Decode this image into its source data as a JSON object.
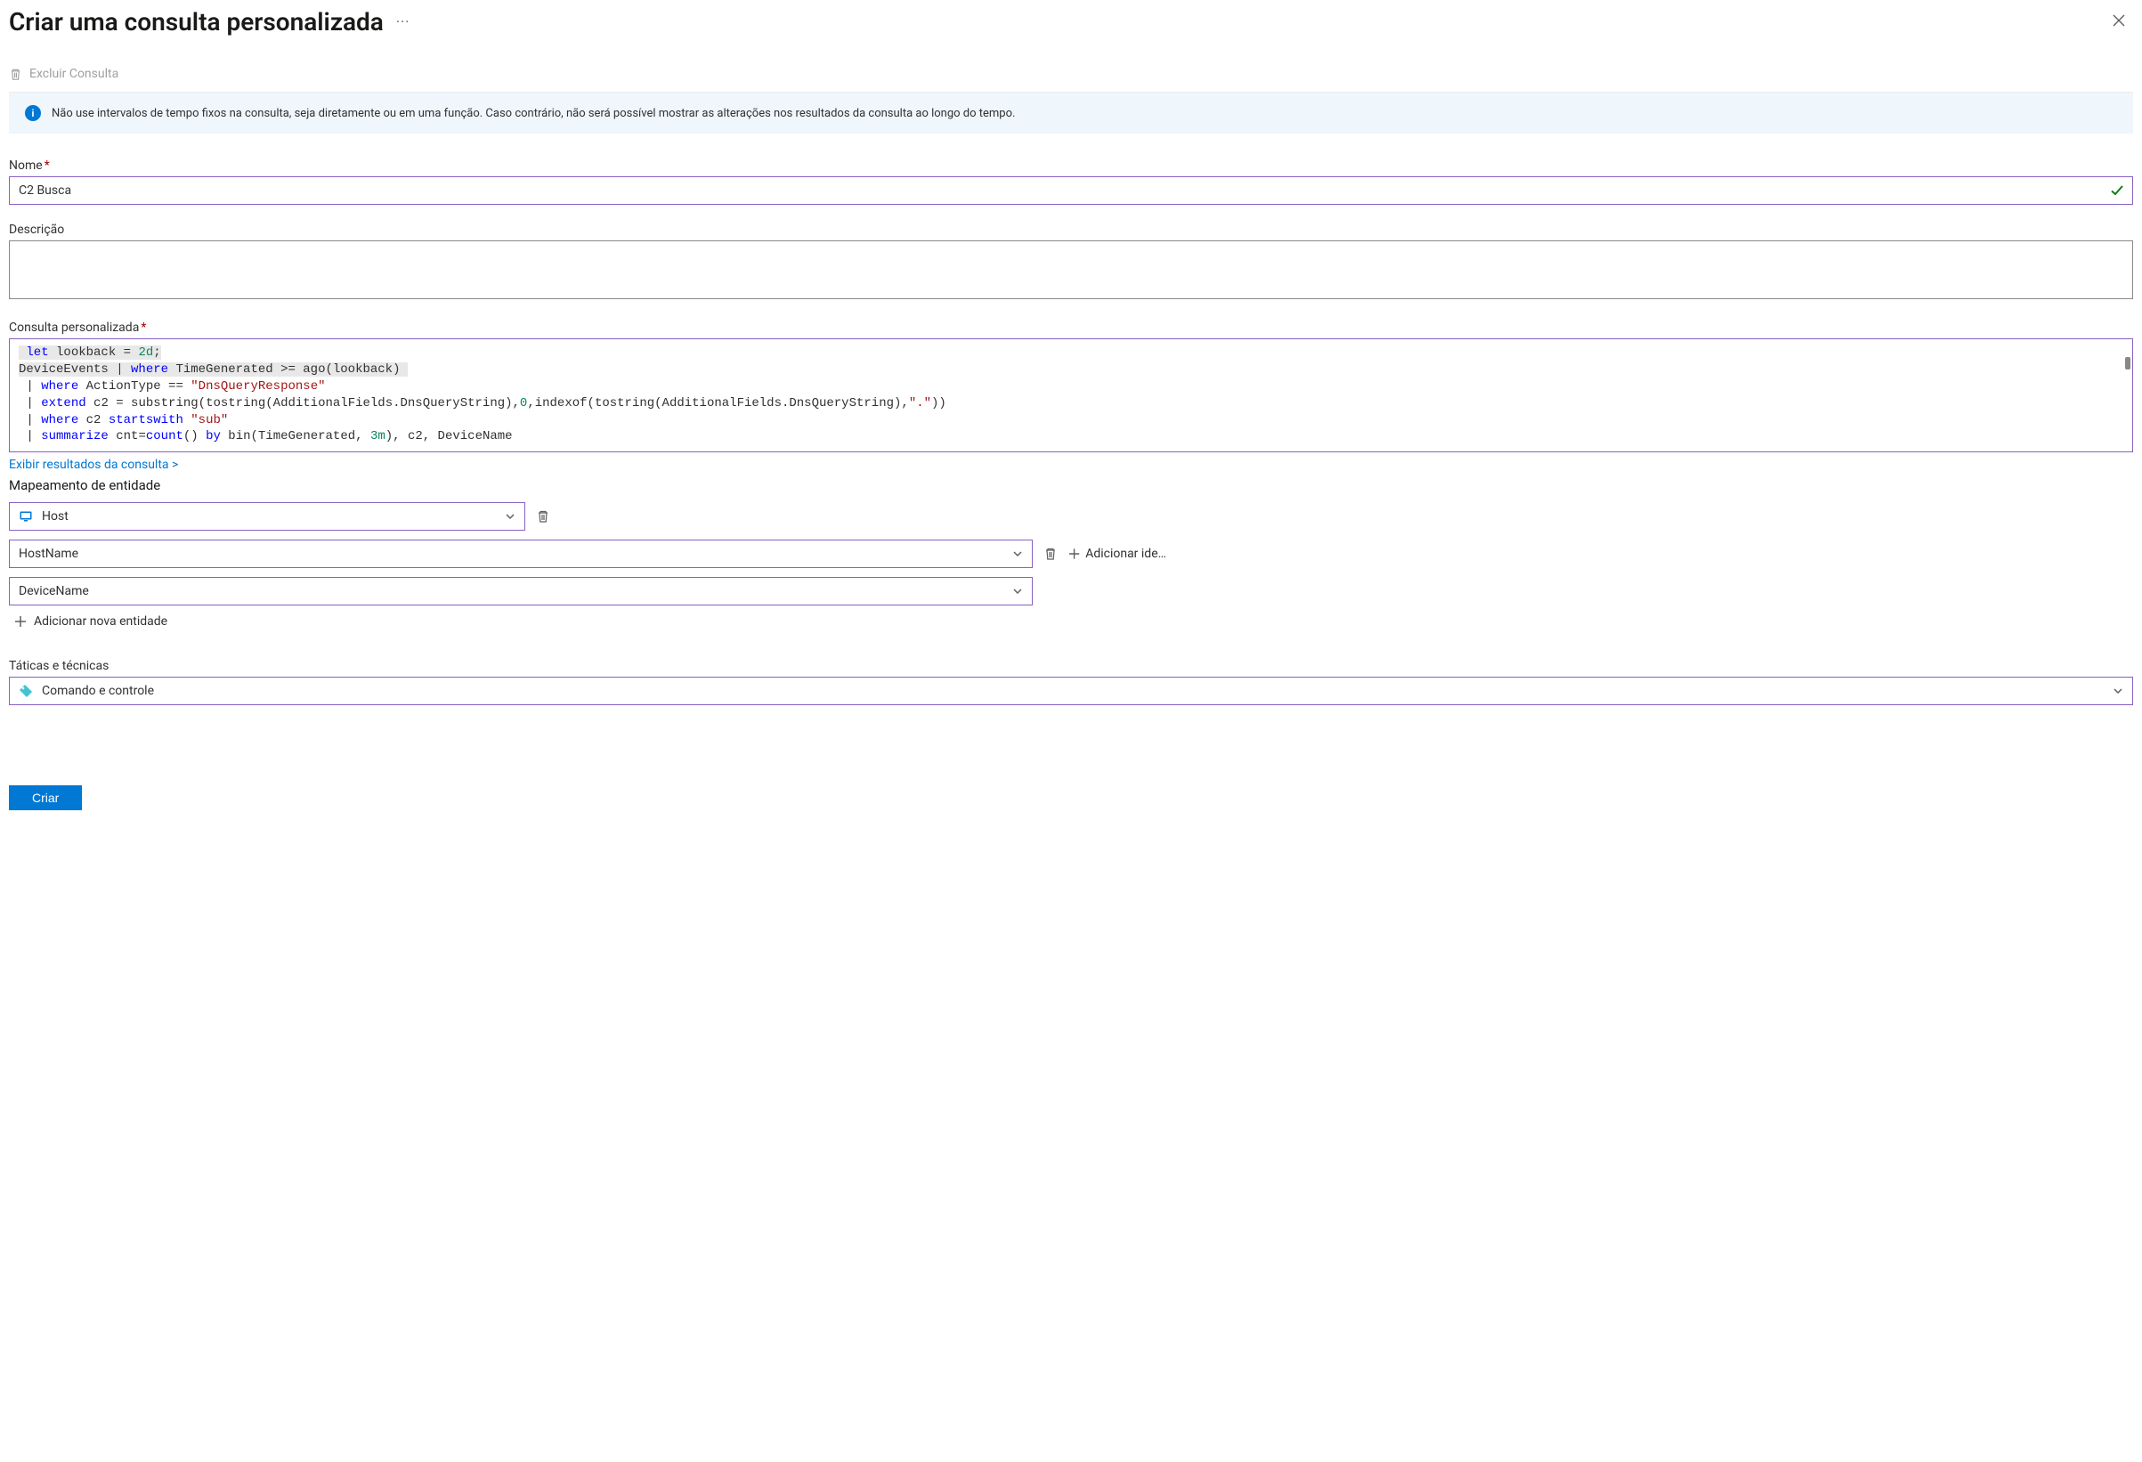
{
  "header": {
    "title": "Criar uma consulta personalizada"
  },
  "toolbar": {
    "delete_label": "Excluir Consulta"
  },
  "banner": {
    "text": "Não use intervalos de tempo fixos na consulta, seja diretamente ou em uma função. Caso contrário, não será possível mostrar as alterações nos resultados da consulta ao longo do tempo."
  },
  "fields": {
    "name_label": "Nome",
    "name_value": "C2 Busca",
    "description_label": "Descrição",
    "description_value": "",
    "query_label": "Consulta personalizada",
    "query_tokens": {
      "l1_let": "let",
      "l1_rest": " lookback = ",
      "l1_num": "2d",
      "l1_semi": ";",
      "l2_a": "DeviceEvents | ",
      "l2_where": "where",
      "l2_b": " TimeGenerated >= ago(lookback)",
      "l3_where": "where",
      "l3_a": " ActionType == ",
      "l3_str": "\"DnsQueryResponse\"",
      "l4_extend": "extend",
      "l4_a": " c2 = substring(tostring(AdditionalFields.DnsQueryString),",
      "l4_num": "0",
      "l4_b": ",indexof(tostring(AdditionalFields.DnsQueryString),",
      "l4_str": "\".\"",
      "l4_c": "))",
      "l5_where": "where",
      "l5_a": " c2 ",
      "l5_sw": "startswith",
      "l5_sp": " ",
      "l5_str": "\"sub\"",
      "l6_sum": "summarize",
      "l6_a": " cnt=",
      "l6_count": "count",
      "l6_b": "() ",
      "l6_by": "by",
      "l6_c": " bin(TimeGenerated, ",
      "l6_num": "3m",
      "l6_d": "), c2, DeviceName"
    },
    "view_results_link": "Exibir resultados da consulta >"
  },
  "entity": {
    "section_label": "Mapeamento de entidade",
    "type_value": "Host",
    "identifier_value": "HostName",
    "column_value": "DeviceName",
    "add_identifier_label": "Adicionar ide…",
    "add_entity_label": "Adicionar nova entidade"
  },
  "tactics": {
    "label": "Táticas e técnicas",
    "value": "Comando e controle"
  },
  "footer": {
    "create_label": "Criar"
  }
}
